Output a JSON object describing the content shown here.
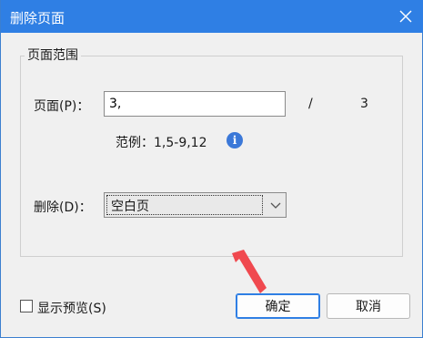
{
  "dialog": {
    "title": "删除页面"
  },
  "group": {
    "title": "页面范围",
    "page_label": "页面(P)：",
    "page_value": "3,",
    "separator": "/",
    "total_pages": "3",
    "example_text": "范例：1,5-9,12",
    "info_icon": "info-icon"
  },
  "delete": {
    "label": "删除(D)：",
    "selected": "空白页"
  },
  "footer": {
    "preview_label": "显示预览(S)",
    "ok_label": "确定",
    "cancel_label": "取消"
  },
  "colors": {
    "titlebar": "#2f7fe4",
    "annotation_arrow": "#f0494f"
  }
}
